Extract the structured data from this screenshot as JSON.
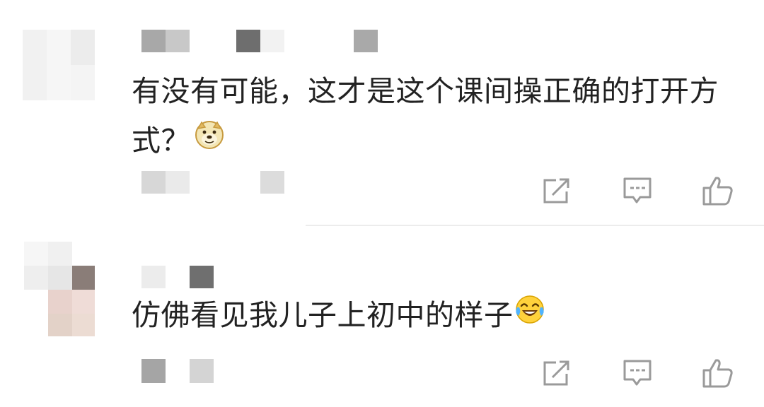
{
  "comments": [
    {
      "text": "有没有可能，这才是这个课间操正确的打开方式？",
      "emoji": "doge-emoji",
      "author_redacted": true,
      "meta_redacted": true
    },
    {
      "text": "仿佛看见我儿子上初中的样子",
      "emoji": "laughing-crying-emoji",
      "author_redacted": true,
      "meta_redacted": true
    }
  ],
  "actions": {
    "share_icon": "share-icon",
    "reply_icon": "comment-icon",
    "like_icon": "thumbs-up-icon"
  },
  "colors": {
    "text": "#222222",
    "icon": "#9a9a9a",
    "divider": "#ececec"
  }
}
